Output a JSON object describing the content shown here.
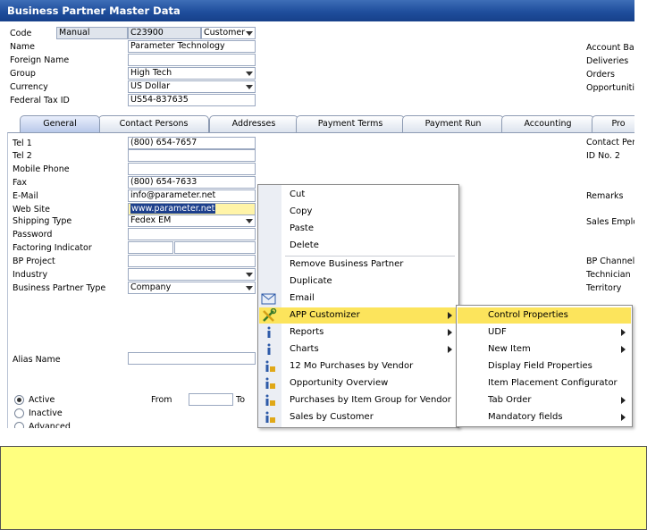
{
  "window": {
    "title": "Business Partner Master Data"
  },
  "header": {
    "code_label": "Code",
    "code_series": "Manual",
    "code_value": "C23900",
    "code_type": "Customer",
    "name_label": "Name",
    "name_value": "Parameter Technology",
    "foreign_name_label": "Foreign Name",
    "foreign_name_value": "",
    "group_label": "Group",
    "group_value": "High Tech",
    "currency_label": "Currency",
    "currency_value": "US Dollar",
    "fedtax_label": "Federal Tax ID",
    "fedtax_value": "US54-837635"
  },
  "right_panel": {
    "items": [
      "Account Ba",
      "Deliveries",
      "Orders",
      "Opportuniti"
    ]
  },
  "tabs": [
    "General",
    "Contact Persons",
    "Addresses",
    "Payment Terms",
    "Payment Run",
    "Accounting",
    "Pro"
  ],
  "general": {
    "tel1_label": "Tel 1",
    "tel1_value": "(800) 654-7657",
    "tel2_label": "Tel 2",
    "tel2_value": "",
    "mobile_label": "Mobile Phone",
    "mobile_value": "",
    "fax_label": "Fax",
    "fax_value": "(800) 654-7633",
    "email_label": "E-Mail",
    "email_value": "info@parameter.net",
    "website_label": "Web Site",
    "website_value": "www.parameter.net",
    "shipping_label": "Shipping Type",
    "shipping_value": "Fedex EM",
    "password_label": "Password",
    "factoring_label": "Factoring Indicator",
    "bpproject_label": "BP Project",
    "industry_label": "Industry",
    "bptype_label": "Business Partner Type",
    "bptype_value": "Company",
    "alias_label": "Alias Name",
    "status_active": "Active",
    "status_inactive": "Inactive",
    "status_advanced": "Advanced",
    "from_label": "From",
    "to_label": "To"
  },
  "general_right": {
    "items": [
      "Contact Per",
      "ID No. 2",
      "Remarks",
      "Sales Emplo",
      "BP Channel",
      "Technician",
      "Territory"
    ]
  },
  "context_menu": {
    "cut": "Cut",
    "copy": "Copy",
    "paste": "Paste",
    "delete": "Delete",
    "remove_bp": "Remove Business Partner",
    "duplicate": "Duplicate",
    "email": "Email",
    "app_customizer": "APP Customizer",
    "reports": "Reports",
    "charts": "Charts",
    "purchases_vendor": "12 Mo Purchases by Vendor",
    "opportunity_overview": "Opportunity Overview",
    "purchases_item_group": "Purchases by Item Group for Vendor",
    "sales_customer": "Sales by Customer"
  },
  "submenu": {
    "control_properties": "Control Properties",
    "udf": "UDF",
    "new_item": "New Item",
    "display_field_properties": "Display Field Properties",
    "item_placement": "Item Placement Configurator",
    "tab_order": "Tab Order",
    "mandatory_fields": "Mandatory fields"
  },
  "colors": {
    "title_bar": "#1f4e9c",
    "menu_highlight": "#fce45c",
    "note_background": "#ffff7f",
    "selected_field": "#fff4a8"
  }
}
